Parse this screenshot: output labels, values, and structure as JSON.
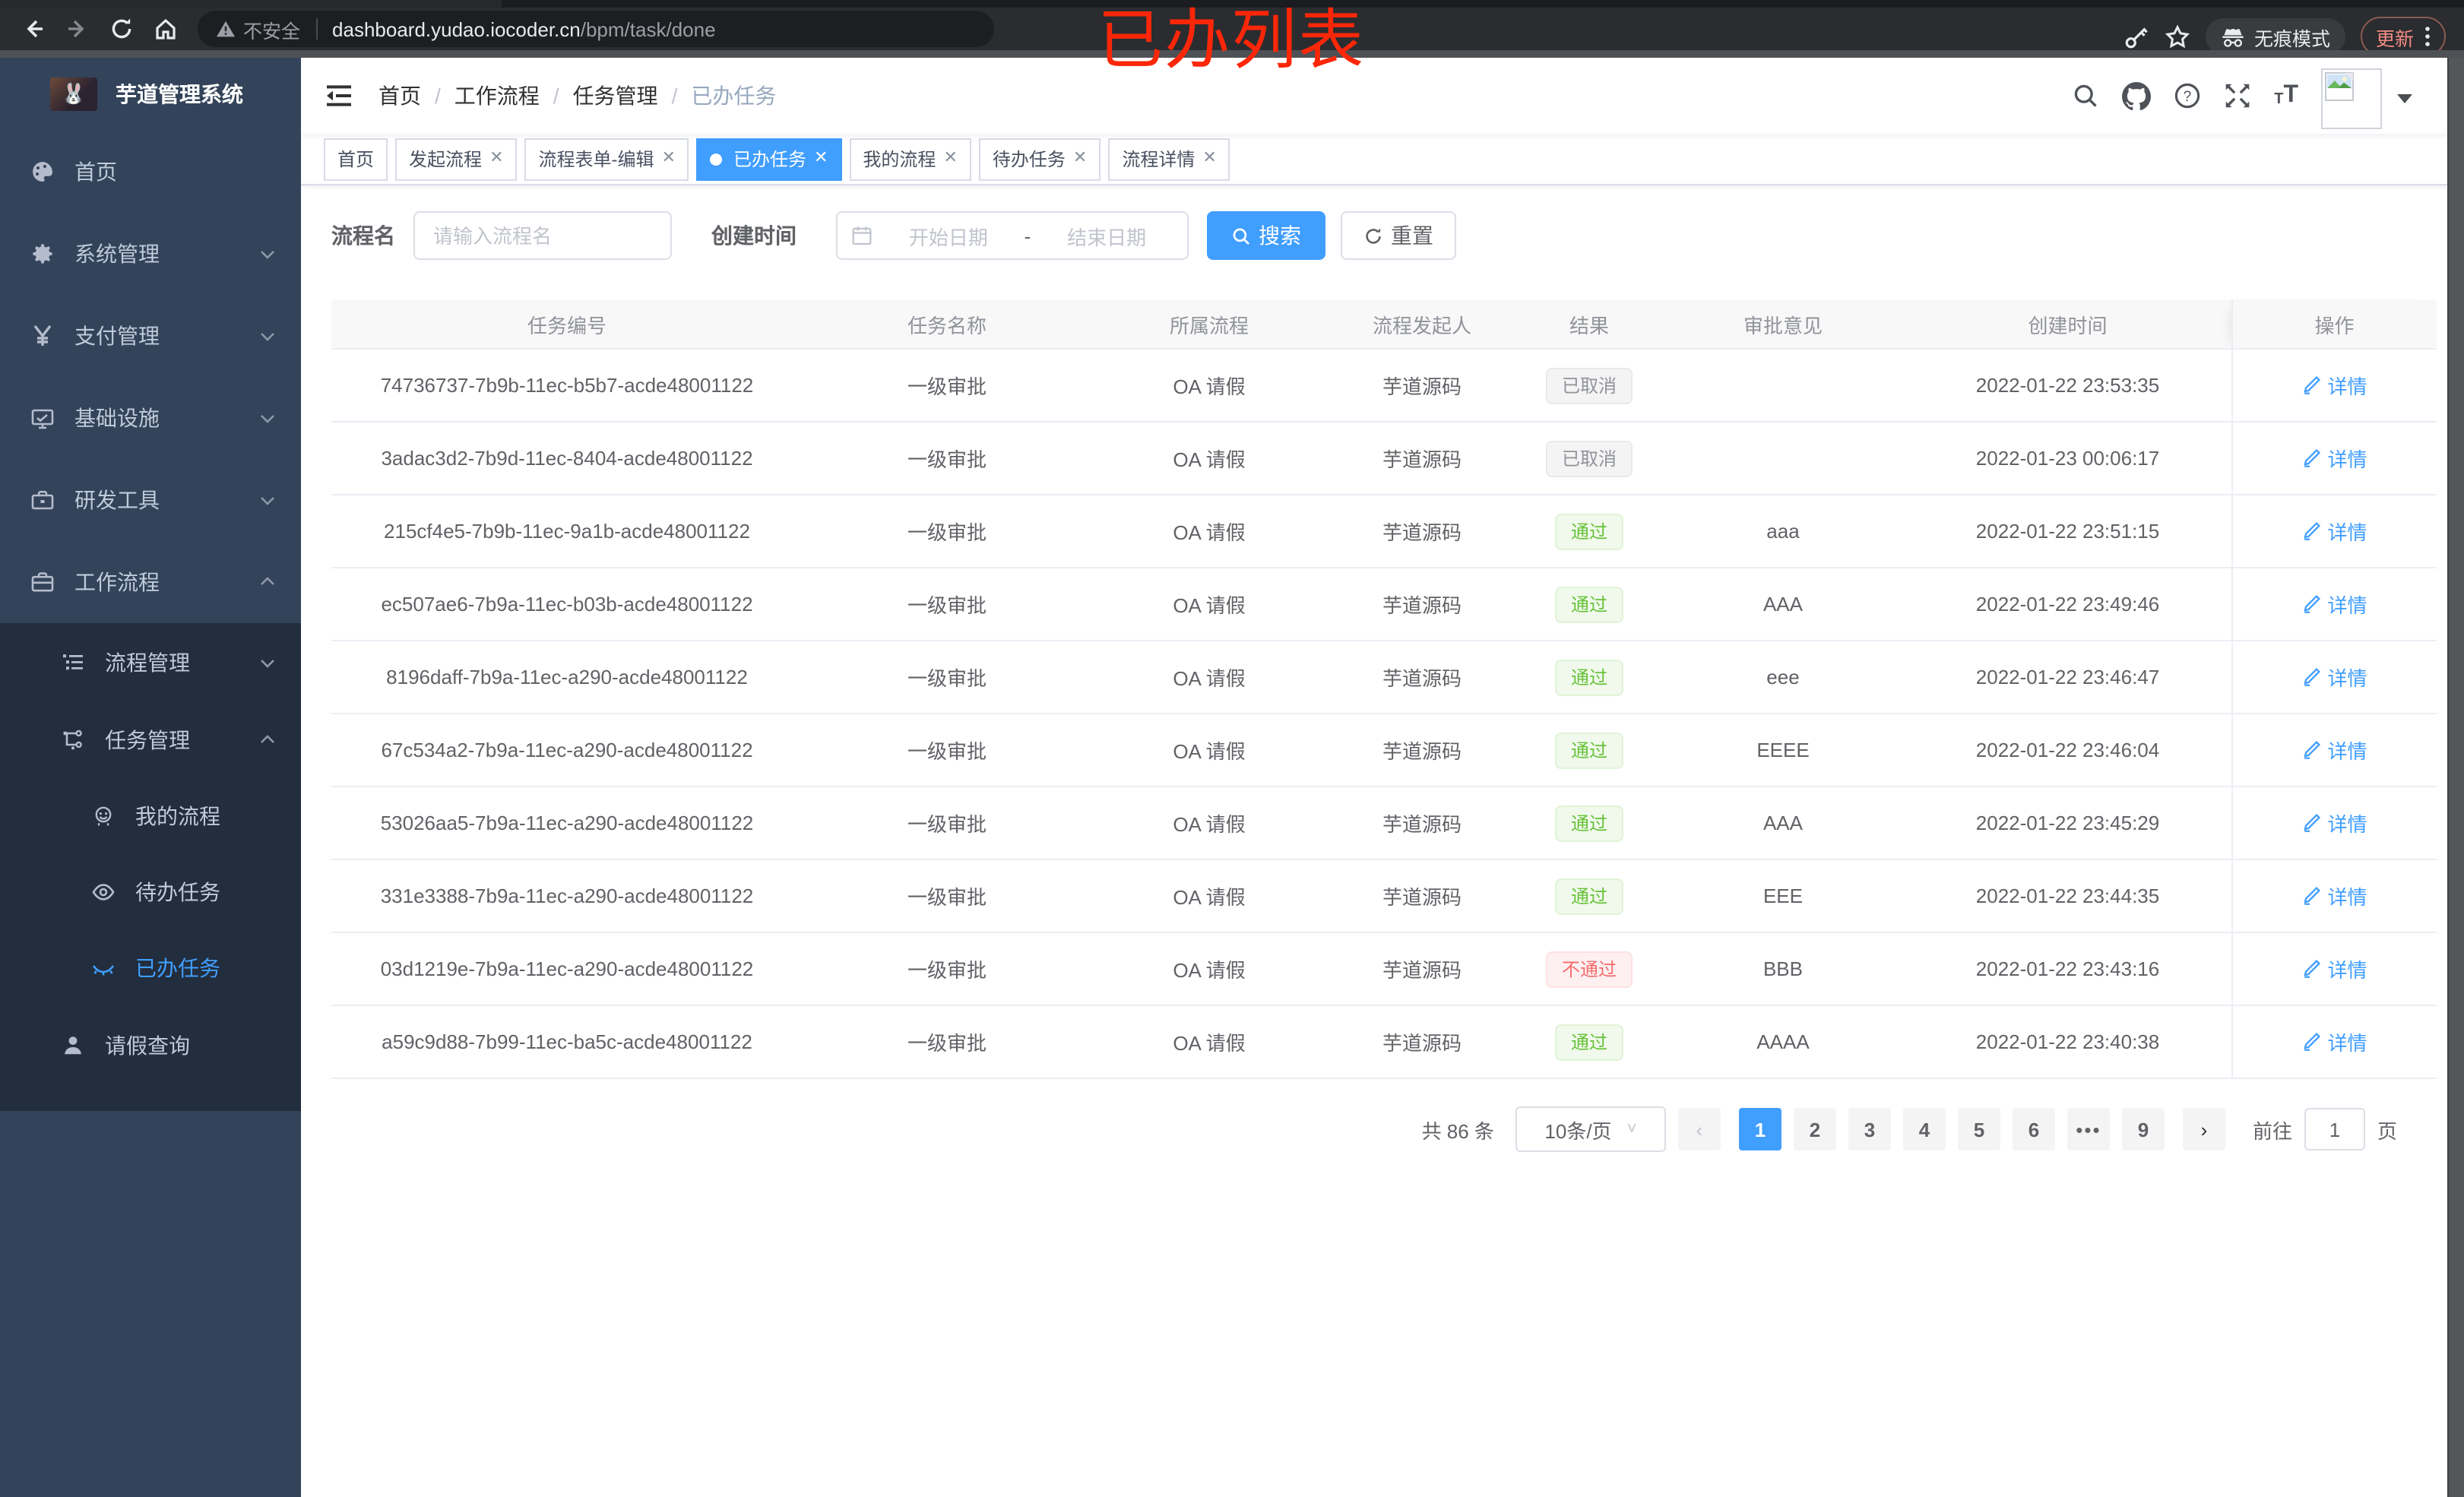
{
  "colors": {
    "accent": "#409eff",
    "success": "#67c23a",
    "danger": "#f56c6c",
    "info": "#909399",
    "annotation_red": "#fb2708",
    "sidebar_bg": "#33435a",
    "submenu_bg": "#222d3d"
  },
  "browser": {
    "security_label": "不安全",
    "url_host": "dashboard.yudao.iocoder.cn",
    "url_path": "/bpm/task/done",
    "incognito_label": "无痕模式",
    "update_label": "更新",
    "annotation": "已办列表"
  },
  "sidebar": {
    "logo_title": "芋道管理系统",
    "menu": [
      {
        "label": "首页",
        "icon": "dashboard-icon"
      },
      {
        "label": "系统管理",
        "icon": "gear-icon"
      },
      {
        "label": "支付管理",
        "icon": "yen-icon"
      },
      {
        "label": "基础设施",
        "icon": "monitor-icon"
      },
      {
        "label": "研发工具",
        "icon": "toolbox-icon"
      },
      {
        "label": "工作流程",
        "icon": "briefcase-icon"
      }
    ],
    "submenu": [
      {
        "label": "流程管理",
        "icon": "list-icon"
      },
      {
        "label": "任务管理",
        "icon": "flow-icon"
      },
      {
        "label": "我的流程",
        "icon": "face-icon"
      },
      {
        "label": "待办任务",
        "icon": "eye-open-icon"
      },
      {
        "label": "已办任务",
        "icon": "eye-closed-icon"
      },
      {
        "label": "请假查询",
        "icon": "user-icon"
      }
    ]
  },
  "header": {
    "breadcrumb": [
      "首页",
      "工作流程",
      "任务管理",
      "已办任务"
    ],
    "separator": "/"
  },
  "tabs": [
    {
      "label": "首页"
    },
    {
      "label": "发起流程"
    },
    {
      "label": "流程表单-编辑"
    },
    {
      "label": "已办任务"
    },
    {
      "label": "我的流程"
    },
    {
      "label": "待办任务"
    },
    {
      "label": "流程详情"
    }
  ],
  "filters": {
    "name_label": "流程名",
    "name_placeholder": "请输入流程名",
    "time_label": "创建时间",
    "start_placeholder": "开始日期",
    "range_separator": "-",
    "end_placeholder": "结束日期",
    "search_label": "搜索",
    "reset_label": "重置"
  },
  "table": {
    "columns": [
      "任务编号",
      "任务名称",
      "所属流程",
      "流程发起人",
      "结果",
      "审批意见",
      "创建时间",
      "操作"
    ],
    "action_label": "详情",
    "rows": [
      {
        "id": "74736737-7b9b-11ec-b5b7-acde48001122",
        "name": "一级审批",
        "flow": "OA 请假",
        "starter": "芋道源码",
        "result": "已取消",
        "comment": "",
        "time": "2022-01-22 23:53:35"
      },
      {
        "id": "3adac3d2-7b9d-11ec-8404-acde48001122",
        "name": "一级审批",
        "flow": "OA 请假",
        "starter": "芋道源码",
        "result": "已取消",
        "comment": "",
        "time": "2022-01-23 00:06:17"
      },
      {
        "id": "215cf4e5-7b9b-11ec-9a1b-acde48001122",
        "name": "一级审批",
        "flow": "OA 请假",
        "starter": "芋道源码",
        "result": "通过",
        "comment": "aaa",
        "time": "2022-01-22 23:51:15"
      },
      {
        "id": "ec507ae6-7b9a-11ec-b03b-acde48001122",
        "name": "一级审批",
        "flow": "OA 请假",
        "starter": "芋道源码",
        "result": "通过",
        "comment": "AAA",
        "time": "2022-01-22 23:49:46"
      },
      {
        "id": "8196daff-7b9a-11ec-a290-acde48001122",
        "name": "一级审批",
        "flow": "OA 请假",
        "starter": "芋道源码",
        "result": "通过",
        "comment": "eee",
        "time": "2022-01-22 23:46:47"
      },
      {
        "id": "67c534a2-7b9a-11ec-a290-acde48001122",
        "name": "一级审批",
        "flow": "OA 请假",
        "starter": "芋道源码",
        "result": "通过",
        "comment": "EEEE",
        "time": "2022-01-22 23:46:04"
      },
      {
        "id": "53026aa5-7b9a-11ec-a290-acde48001122",
        "name": "一级审批",
        "flow": "OA 请假",
        "starter": "芋道源码",
        "result": "通过",
        "comment": "AAA",
        "time": "2022-01-22 23:45:29"
      },
      {
        "id": "331e3388-7b9a-11ec-a290-acde48001122",
        "name": "一级审批",
        "flow": "OA 请假",
        "starter": "芋道源码",
        "result": "通过",
        "comment": "EEE",
        "time": "2022-01-22 23:44:35"
      },
      {
        "id": "03d1219e-7b9a-11ec-a290-acde48001122",
        "name": "一级审批",
        "flow": "OA 请假",
        "starter": "芋道源码",
        "result": "不通过",
        "comment": "BBB",
        "time": "2022-01-22 23:43:16"
      },
      {
        "id": "a59c9d88-7b99-11ec-ba5c-acde48001122",
        "name": "一级审批",
        "flow": "OA 请假",
        "starter": "芋道源码",
        "result": "通过",
        "comment": "AAAA",
        "time": "2022-01-22 23:40:38"
      }
    ]
  },
  "pagination": {
    "total_text": "共 86 条",
    "page_size": "10条/页",
    "pages": [
      "1",
      "2",
      "3",
      "4",
      "5",
      "6",
      "•••",
      "9"
    ],
    "goto_label": "前往",
    "goto_value": "1",
    "goto_suffix": "页"
  }
}
